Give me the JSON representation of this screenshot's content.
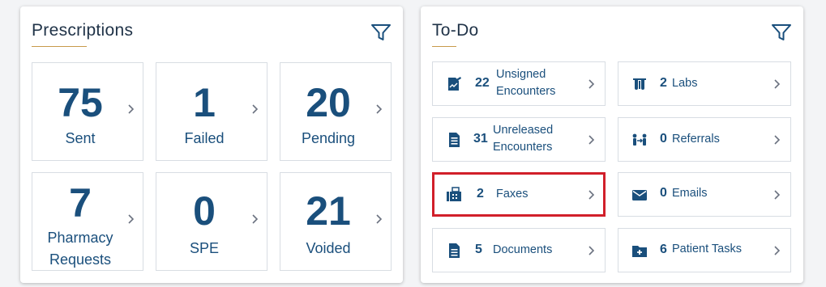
{
  "prescriptions": {
    "title": "Prescriptions",
    "tiles": [
      {
        "count": "75",
        "label_lines": [
          "Sent"
        ]
      },
      {
        "count": "1",
        "label_lines": [
          "Failed"
        ]
      },
      {
        "count": "20",
        "label_lines": [
          "Pending"
        ]
      },
      {
        "count": "7",
        "label_lines": [
          "Pharmacy",
          "Requests"
        ]
      },
      {
        "count": "0",
        "label_lines": [
          "SPE"
        ]
      },
      {
        "count": "21",
        "label_lines": [
          "Voided"
        ]
      }
    ]
  },
  "todo": {
    "title": "To-Do",
    "items": [
      {
        "count": "22",
        "label_lines": [
          "Unsigned",
          "Encounters"
        ],
        "icon": "signed-document-icon"
      },
      {
        "count": "2",
        "label_lines": [
          "Labs"
        ],
        "icon": "lab-flask-icon"
      },
      {
        "count": "31",
        "label_lines": [
          "Unreleased",
          "Encounters"
        ],
        "icon": "document-icon"
      },
      {
        "count": "0",
        "label_lines": [
          "Referrals"
        ],
        "icon": "referral-people-icon"
      },
      {
        "count": "2",
        "label_lines": [
          "Faxes"
        ],
        "icon": "fax-icon"
      },
      {
        "count": "0",
        "label_lines": [
          "Emails"
        ],
        "icon": "email-icon"
      },
      {
        "count": "5",
        "label_lines": [
          "Documents"
        ],
        "icon": "document-lines-icon"
      },
      {
        "count": "6",
        "label_lines": [
          "Patient Tasks"
        ],
        "icon": "add-folder-icon"
      }
    ]
  },
  "colors": {
    "accent": "#1a4f7c",
    "title_underline": "#c89a4a",
    "highlight_border": "#d11f2a",
    "tile_border": "#d8dde3"
  }
}
